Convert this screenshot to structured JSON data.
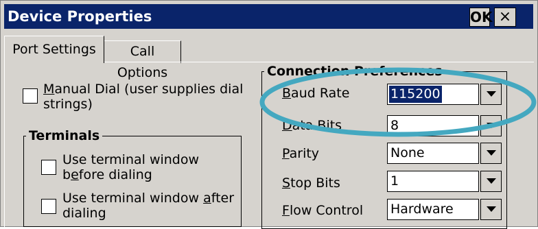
{
  "window": {
    "title": "Device Properties",
    "ok_label": "OK",
    "close_glyph": "×",
    "title_bar_color": "#0a246a"
  },
  "tabs": [
    {
      "label": "Port Settings",
      "selected": true
    },
    {
      "label": "Call Options",
      "selected": false
    }
  ],
  "manual_dial": {
    "label_line1_pre": "",
    "label_line1_key": "M",
    "label_line1_post": "anual Dial (user supplies dial",
    "label_line2": "strings)",
    "checked": false
  },
  "terminals": {
    "title": "Terminals",
    "before": {
      "line1": "Use terminal window",
      "line2_pre": "b",
      "line2_key": "e",
      "line2_post": "fore dialing",
      "checked": false
    },
    "after": {
      "line1_pre": "Use terminal window ",
      "line1_key": "a",
      "line1_post": "fter",
      "line2": "dialing",
      "checked": false
    }
  },
  "connection": {
    "title": "Connection Preferences",
    "rows": [
      {
        "key": "B",
        "rest": "aud Rate",
        "value": "115200",
        "selected": true
      },
      {
        "key": "D",
        "rest": "ata Bits",
        "value": "8",
        "selected": false
      },
      {
        "key": "P",
        "rest": "arity",
        "value": "None",
        "selected": false
      },
      {
        "key": "S",
        "rest": "top Bits",
        "value": "1",
        "selected": false
      },
      {
        "key": "F",
        "rest": "low Control",
        "value": "Hardware",
        "selected": false
      }
    ]
  },
  "highlight_ellipse_color": "#44a8c0"
}
